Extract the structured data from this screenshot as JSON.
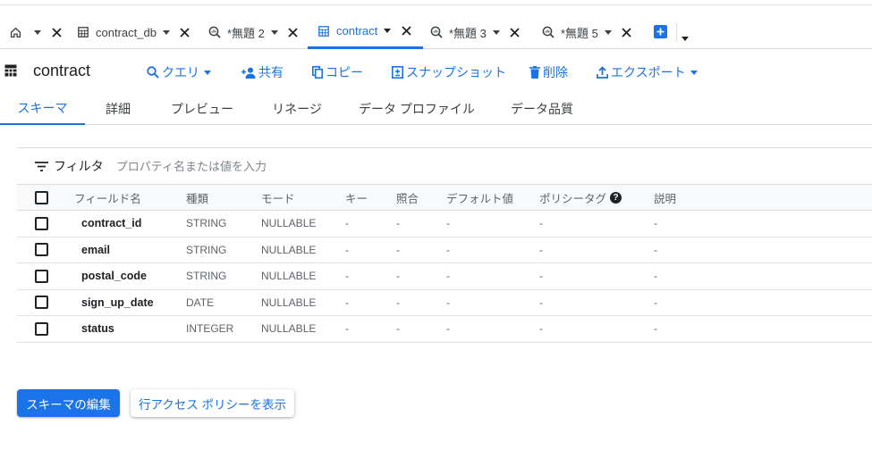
{
  "colors": {
    "accent": "#1a73e8",
    "text": "#202124",
    "muted": "#5f6368",
    "border": "#dadce0"
  },
  "tabs": [
    {
      "icon": "home-icon",
      "label": "",
      "active": false
    },
    {
      "icon": "table-icon",
      "label": "contract_db",
      "active": false
    },
    {
      "icon": "query-icon",
      "label": "*無題 2",
      "active": false
    },
    {
      "icon": "table-icon",
      "label": "contract",
      "active": true
    },
    {
      "icon": "query-icon",
      "label": "*無題 3",
      "active": false
    },
    {
      "icon": "query-icon",
      "label": "*無題 5",
      "active": false
    }
  ],
  "header": {
    "title": "contract",
    "actions": {
      "query": "クエリ",
      "share": "共有",
      "copy": "コピー",
      "snapshot": "スナップショット",
      "delete": "削除",
      "export": "エクスポート"
    }
  },
  "subtabs": [
    "スキーマ",
    "詳細",
    "プレビュー",
    "リネージ",
    "データ プロファイル",
    "データ品質"
  ],
  "filter": {
    "label": "フィルタ",
    "placeholder": "プロパティ名または値を入力"
  },
  "table": {
    "headers": [
      "フィールド名",
      "種類",
      "モード",
      "キー",
      "照合",
      "デフォルト値",
      "ポリシータグ",
      "説明"
    ],
    "rows": [
      [
        "contract_id",
        "STRING",
        "NULLABLE",
        "-",
        "-",
        "-",
        "-",
        "-"
      ],
      [
        "email",
        "STRING",
        "NULLABLE",
        "-",
        "-",
        "-",
        "-",
        "-"
      ],
      [
        "postal_code",
        "STRING",
        "NULLABLE",
        "-",
        "-",
        "-",
        "-",
        "-"
      ],
      [
        "sign_up_date",
        "DATE",
        "NULLABLE",
        "-",
        "-",
        "-",
        "-",
        "-"
      ],
      [
        "status",
        "INTEGER",
        "NULLABLE",
        "-",
        "-",
        "-",
        "-",
        "-"
      ]
    ]
  },
  "buttons": {
    "edit_schema": "スキーマの編集",
    "row_access": "行アクセス ポリシーを表示"
  }
}
